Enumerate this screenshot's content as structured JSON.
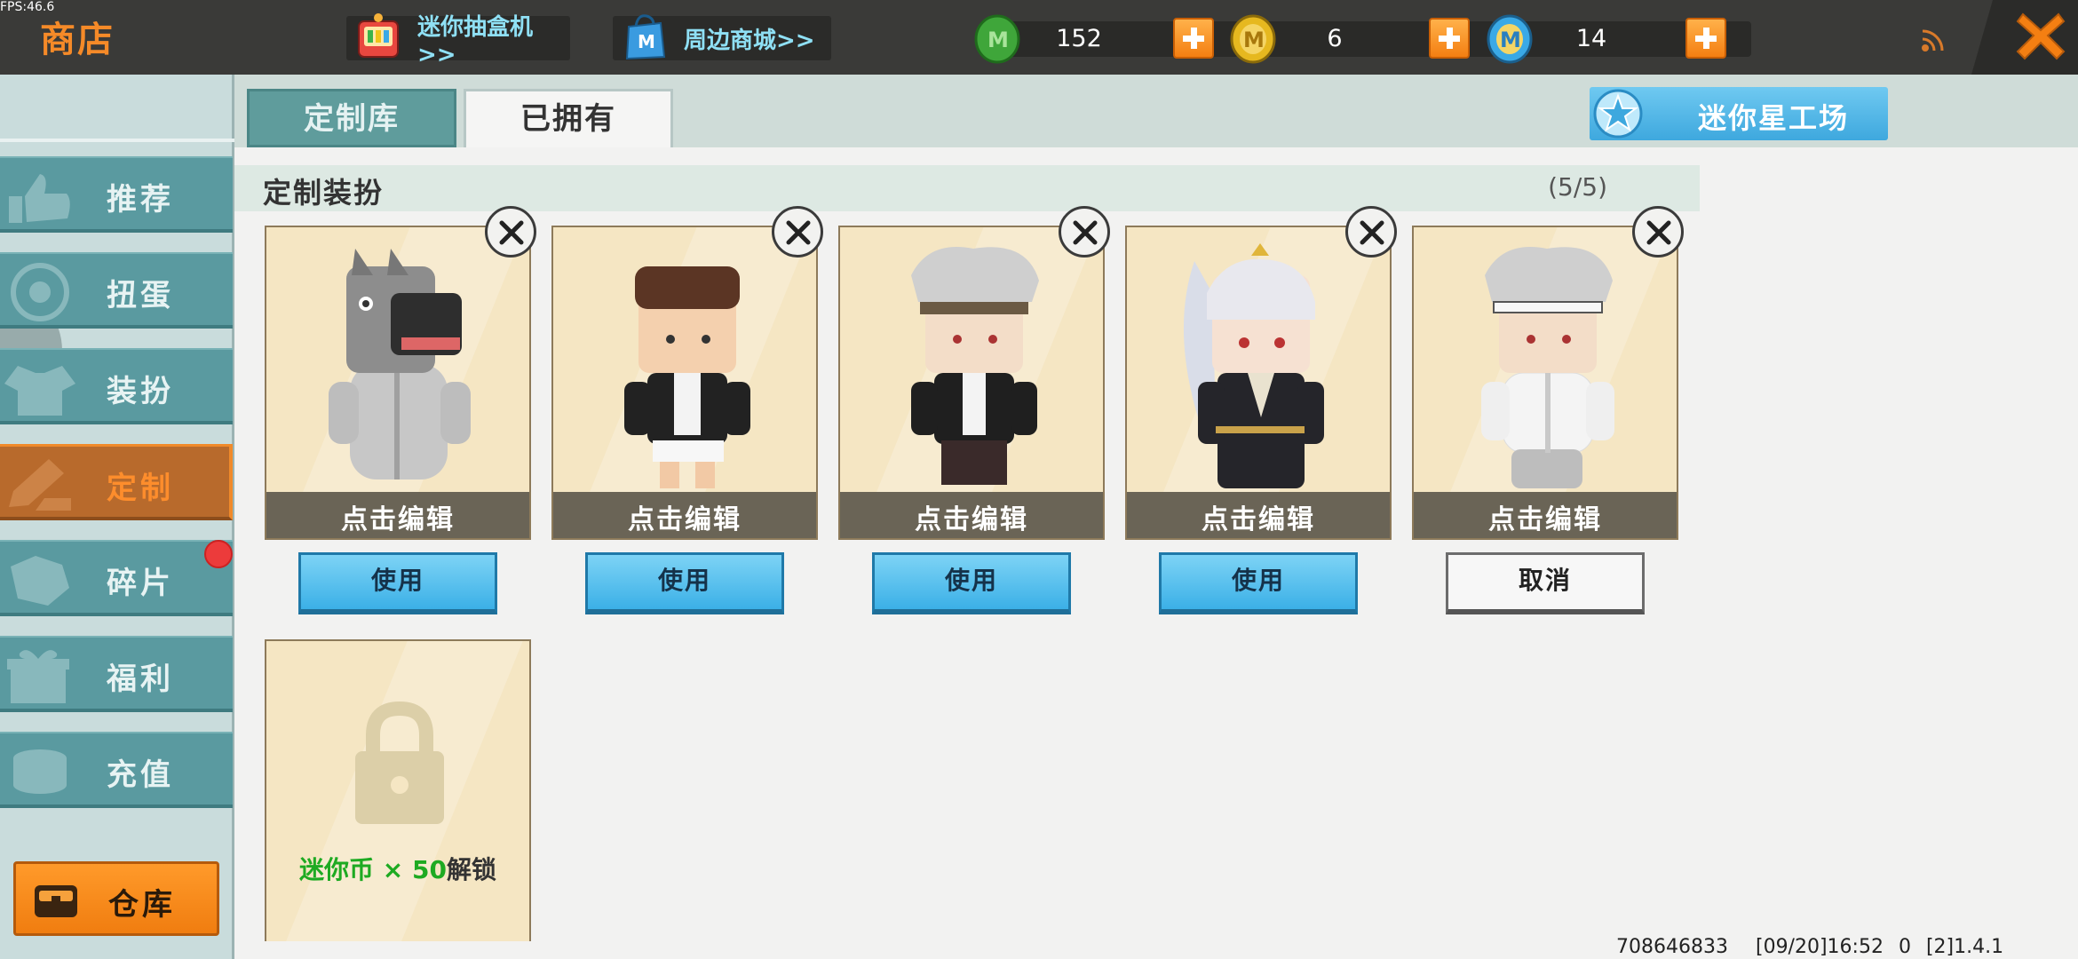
{
  "fps": "FPS:46.6",
  "header": {
    "title": "商店",
    "promo_gacha": "迷你抽盒机>>",
    "promo_mall": "周边商城>>",
    "currencies": [
      {
        "name": "mini-bean",
        "value": "152",
        "color": "#3fa63a"
      },
      {
        "name": "mini-coin",
        "value": "6",
        "color": "#e6b81f"
      },
      {
        "name": "mini-point",
        "value": "14",
        "color": "#3aa9e6"
      }
    ]
  },
  "sidebar": {
    "items": [
      {
        "label": "推荐"
      },
      {
        "label": "扭蛋"
      },
      {
        "label": "装扮"
      },
      {
        "label": "定制"
      },
      {
        "label": "碎片"
      },
      {
        "label": "福利"
      },
      {
        "label": "充值"
      }
    ],
    "active": "定制",
    "warehouse_label": "仓库"
  },
  "tabs": {
    "custom_library": "定制库",
    "owned": "已拥有",
    "workshop": "迷你星工场"
  },
  "section": {
    "title": "定制装扮",
    "count": "(5/5)"
  },
  "cards": [
    {
      "caption": "点击编辑",
      "action": "使用",
      "character": "horse-head-costume"
    },
    {
      "caption": "点击编辑",
      "action": "使用",
      "character": "brown-hair-jacket"
    },
    {
      "caption": "点击编辑",
      "action": "使用",
      "character": "gray-hair-headband-black"
    },
    {
      "caption": "点击编辑",
      "action": "使用",
      "character": "white-ponytail-robe"
    },
    {
      "caption": "点击编辑",
      "action": "取消",
      "character": "gray-hair-headband-white"
    }
  ],
  "locked_slot": {
    "cost_text": "迷你币 × 50",
    "unlock_text": "解锁"
  },
  "footer": {
    "uid": "708646833",
    "timestamp": "[09/20]16:52",
    "extra": "0",
    "version": "[2]1.4.1"
  }
}
